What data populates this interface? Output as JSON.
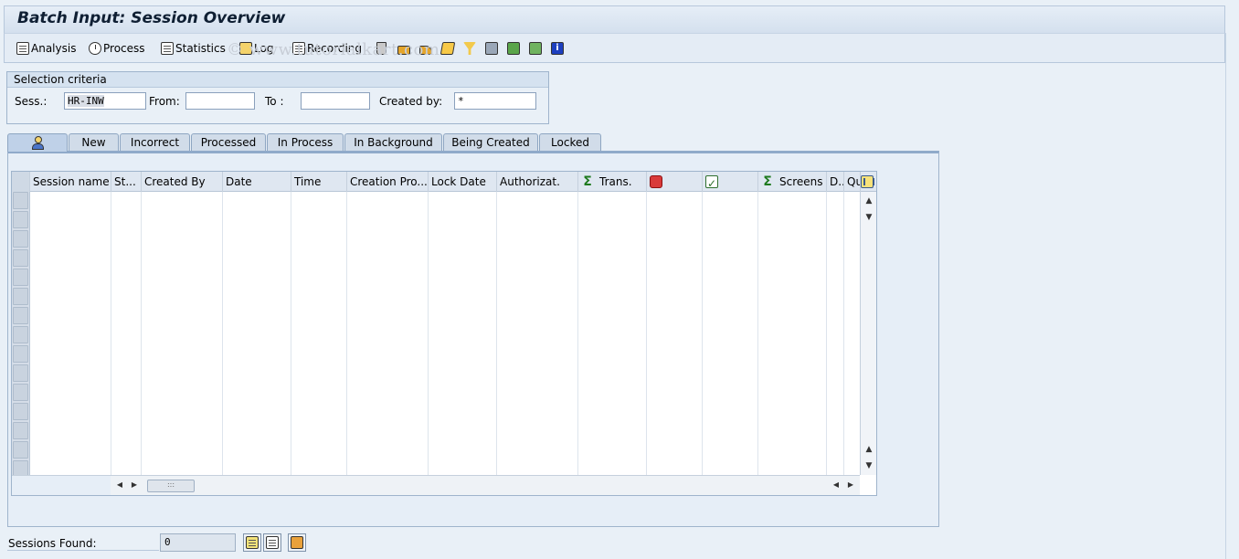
{
  "window": {
    "title": "Batch Input: Session Overview",
    "watermark": "© www.tutorialkart.com"
  },
  "toolbar": {
    "analysis_label": "Analysis",
    "process_label": "Process",
    "statistics_label": "Statistics",
    "log_label": "Log",
    "recording_label": "Recording",
    "icon_buttons": [
      "delete-icon",
      "lock-icon",
      "unlock-icon",
      "flag-icon",
      "filter-icon",
      "print-icon",
      "export-icon",
      "export-file-icon",
      "info-icon"
    ]
  },
  "selection": {
    "header": "Selection criteria",
    "sess_label": "Sess.:",
    "sess_value": "HR-INW",
    "from_label": "From:",
    "from_value": "",
    "to_label": "To :",
    "to_value": "",
    "created_by_label": "Created by:",
    "created_by_value": "*"
  },
  "tabs": [
    {
      "label": "",
      "icon": "person-icon",
      "active": true
    },
    {
      "label": "New"
    },
    {
      "label": "Incorrect"
    },
    {
      "label": "Processed"
    },
    {
      "label": "In Process"
    },
    {
      "label": "In Background"
    },
    {
      "label": "Being Created"
    },
    {
      "label": "Locked"
    }
  ],
  "grid": {
    "columns": [
      "Session name",
      "St...",
      "Created By",
      "Date",
      "Time",
      "Creation Pro...",
      "Lock Date",
      "Authorizat.",
      "Trans.",
      "",
      "",
      "Screens",
      "D..",
      "Qu"
    ],
    "column_icons": {
      "8": "sum-icon",
      "9": "error-icon",
      "10": "check-icon",
      "11": "sum-icon"
    },
    "rows": []
  },
  "footer": {
    "sessions_found_label": "Sessions Found:",
    "sessions_found_value": "0"
  },
  "colors": {
    "background": "#e9f0f7",
    "header": "#d5e2f0",
    "accent": "#90aaca"
  }
}
